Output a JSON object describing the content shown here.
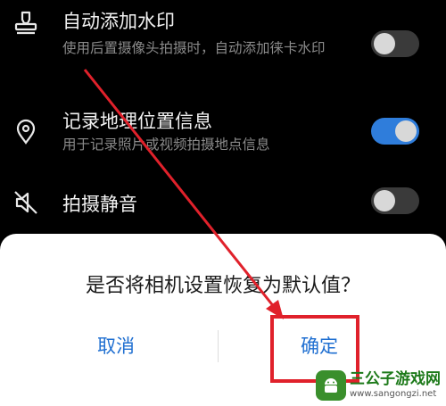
{
  "settings": [
    {
      "title": "自动添加水印",
      "subtitle": "使用后置摄像头拍摄时，自动添加徕卡水印",
      "toggle": "off",
      "icon": "stamp-icon"
    },
    {
      "title": "记录地理位置信息",
      "subtitle": "用于记录照片或视频拍摄地点信息",
      "toggle": "on",
      "icon": "location-pin-icon"
    },
    {
      "title": "拍摄静音",
      "subtitle": "",
      "toggle": "off",
      "icon": "mute-speaker-icon"
    }
  ],
  "dialog": {
    "question": "是否将相机设置恢复为默认值？",
    "cancel_label": "取消",
    "confirm_label": "确定"
  },
  "watermark": {
    "name": "三公子游戏网",
    "url": "www.sangongzi.net"
  },
  "colors": {
    "accent": "#2f7ddb",
    "highlight": "#e0212b",
    "background": "#000000"
  }
}
